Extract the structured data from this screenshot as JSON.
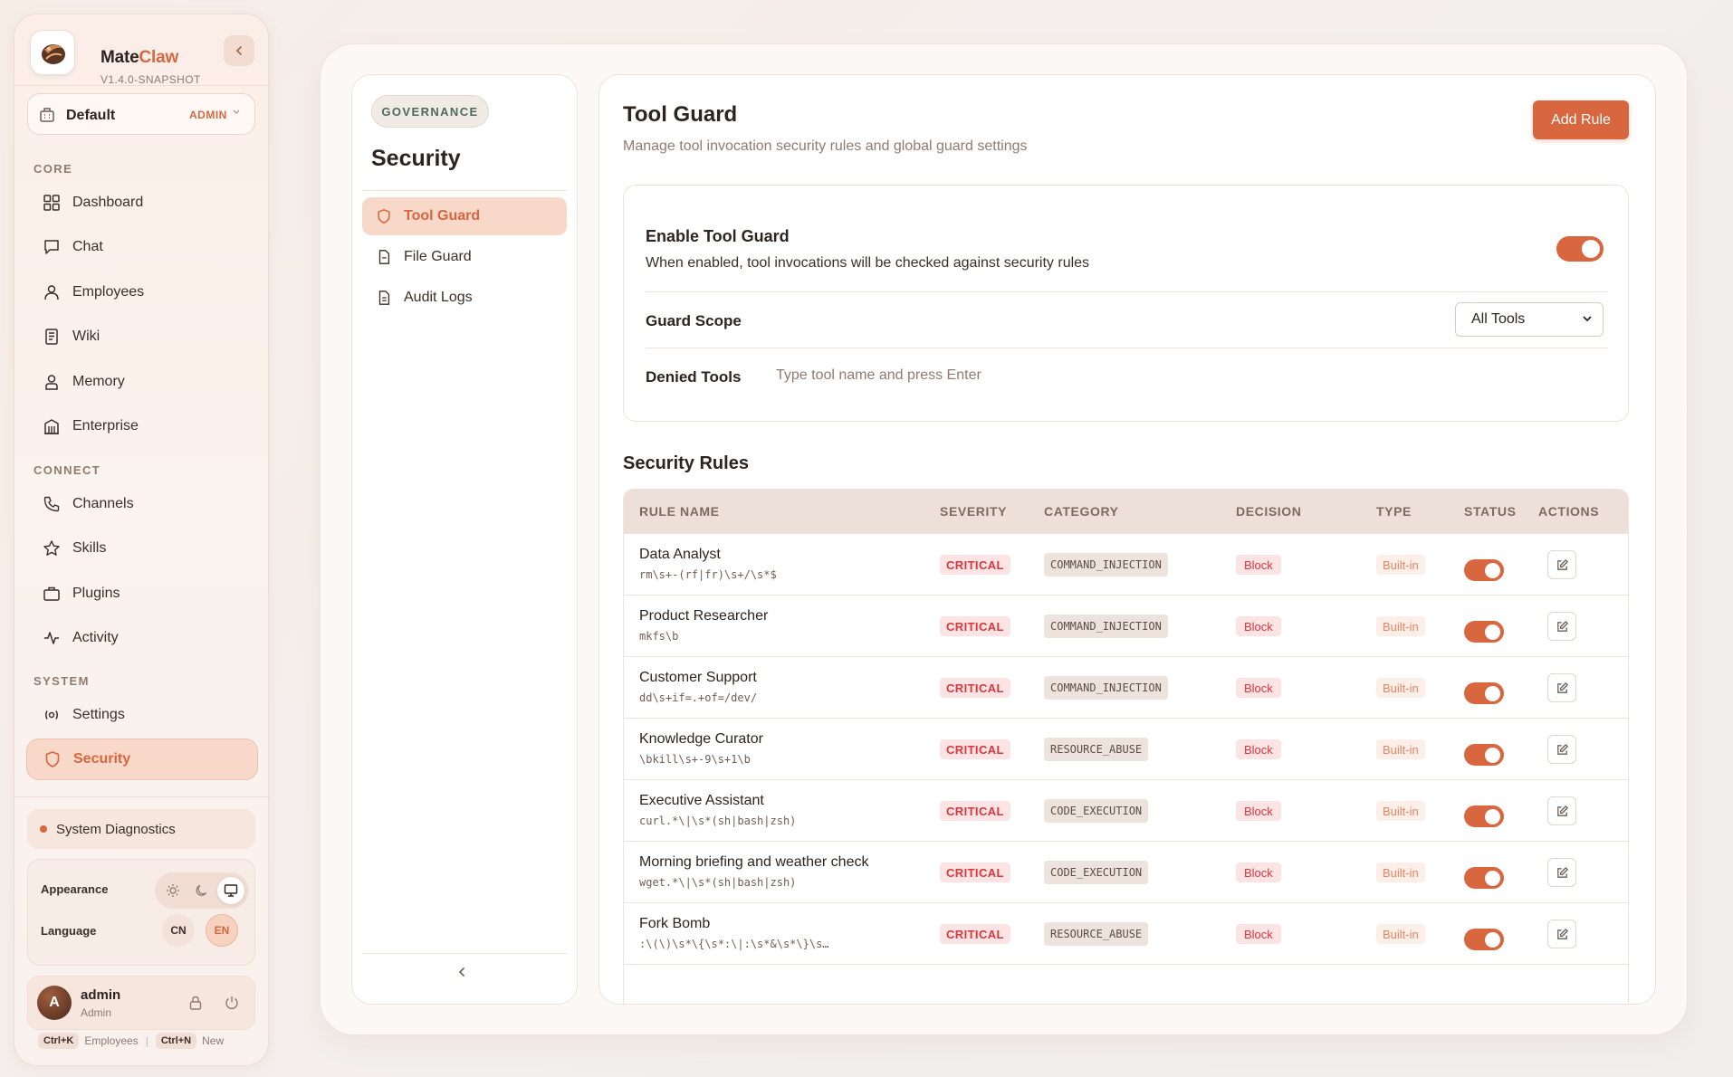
{
  "brand": {
    "name_part1": "Mate",
    "name_part2": "Claw",
    "version": "V1.4.0-SNAPSHOT"
  },
  "workspace": {
    "name": "Default",
    "badge": "ADMIN"
  },
  "sidebar": {
    "sections": {
      "core": "CORE",
      "connect": "CONNECT",
      "system": "SYSTEM"
    },
    "items": [
      {
        "label": "Dashboard",
        "icon": "dashboard-icon"
      },
      {
        "label": "Chat",
        "icon": "chat-icon"
      },
      {
        "label": "Employees",
        "icon": "user-icon"
      },
      {
        "label": "Wiki",
        "icon": "book-icon"
      },
      {
        "label": "Memory",
        "icon": "memory-icon"
      },
      {
        "label": "Enterprise",
        "icon": "building-icon"
      },
      {
        "label": "Channels",
        "icon": "phone-icon"
      },
      {
        "label": "Skills",
        "icon": "star-icon"
      },
      {
        "label": "Plugins",
        "icon": "briefcase-icon"
      },
      {
        "label": "Activity",
        "icon": "activity-icon"
      },
      {
        "label": "Settings",
        "icon": "settings-icon"
      },
      {
        "label": "Security",
        "icon": "shield-icon",
        "active": true
      }
    ],
    "diagnostics": "System Diagnostics",
    "appearance_label": "Appearance",
    "language_label": "Language",
    "languages": [
      "CN",
      "EN"
    ],
    "selected_language": "EN",
    "user": {
      "initial": "A",
      "name": "admin",
      "role": "Admin"
    },
    "shortcuts": [
      {
        "key": "Ctrl+K",
        "label": "Employees"
      },
      {
        "key": "Ctrl+N",
        "label": "New"
      }
    ]
  },
  "subnav": {
    "chip": "GOVERNANCE",
    "title": "Security",
    "items": [
      {
        "label": "Tool Guard",
        "active": true
      },
      {
        "label": "File Guard"
      },
      {
        "label": "Audit Logs"
      }
    ]
  },
  "main": {
    "title": "Tool Guard",
    "subtitle": "Manage tool invocation security rules and global guard settings",
    "add_rule_label": "Add Rule",
    "guard": {
      "enable_title": "Enable Tool Guard",
      "enable_desc": "When enabled, tool invocations will be checked against security rules",
      "enabled": true,
      "scope_label": "Guard Scope",
      "scope_value": "All Tools",
      "denied_label": "Denied Tools",
      "denied_placeholder": "Type tool name and press Enter"
    },
    "rules_title": "Security Rules",
    "columns": [
      "RULE NAME",
      "SEVERITY",
      "CATEGORY",
      "DECISION",
      "TYPE",
      "STATUS",
      "ACTIONS"
    ],
    "rules": [
      {
        "name": "Data Analyst",
        "pattern": "rm\\s+-(rf|fr)\\s+/\\s*$",
        "severity": "CRITICAL",
        "category": "COMMAND_INJECTION",
        "decision": "Block",
        "type": "Built-in",
        "enabled": true
      },
      {
        "name": "Product Researcher",
        "pattern": "mkfs\\b",
        "severity": "CRITICAL",
        "category": "COMMAND_INJECTION",
        "decision": "Block",
        "type": "Built-in",
        "enabled": true
      },
      {
        "name": "Customer Support",
        "pattern": "dd\\s+if=.+of=/dev/",
        "severity": "CRITICAL",
        "category": "COMMAND_INJECTION",
        "decision": "Block",
        "type": "Built-in",
        "enabled": true
      },
      {
        "name": "Knowledge Curator",
        "pattern": "\\bkill\\s+-9\\s+1\\b",
        "severity": "CRITICAL",
        "category": "RESOURCE_ABUSE",
        "decision": "Block",
        "type": "Built-in",
        "enabled": true
      },
      {
        "name": "Executive Assistant",
        "pattern": "curl.*\\|\\s*(sh|bash|zsh)",
        "severity": "CRITICAL",
        "category": "CODE_EXECUTION",
        "decision": "Block",
        "type": "Built-in",
        "enabled": true
      },
      {
        "name": "Morning briefing and weather check",
        "pattern": "wget.*\\|\\s*(sh|bash|zsh)",
        "severity": "CRITICAL",
        "category": "CODE_EXECUTION",
        "decision": "Block",
        "type": "Built-in",
        "enabled": true
      },
      {
        "name": "Fork Bomb",
        "pattern": ":\\(\\)\\s*\\{\\s*:\\|:\\s*&\\s*\\}\\s…",
        "severity": "CRITICAL",
        "category": "RESOURCE_ABUSE",
        "decision": "Block",
        "type": "Built-in",
        "enabled": true
      }
    ]
  },
  "colors": {
    "accent": "#d8663f",
    "critical": "#d9363e"
  }
}
